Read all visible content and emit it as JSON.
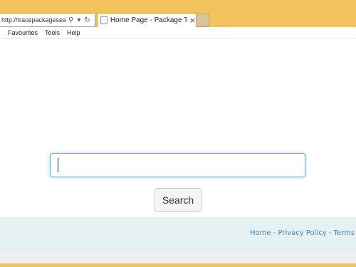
{
  "browser": {
    "address": "http://tracepackagesearc...",
    "tab_title": "Home Page - Package Trac...",
    "tab_close": "×",
    "icons": [
      "search-icon",
      "dropdown-arrow-icon",
      "refresh-icon"
    ]
  },
  "menu": {
    "items": [
      "Favourites",
      "Tools",
      "Help"
    ]
  },
  "search": {
    "input_value": "",
    "button_label": "Search"
  },
  "footer": {
    "links": [
      "Home",
      "Privacy Policy",
      "Terms Of U"
    ],
    "separator": " - "
  }
}
